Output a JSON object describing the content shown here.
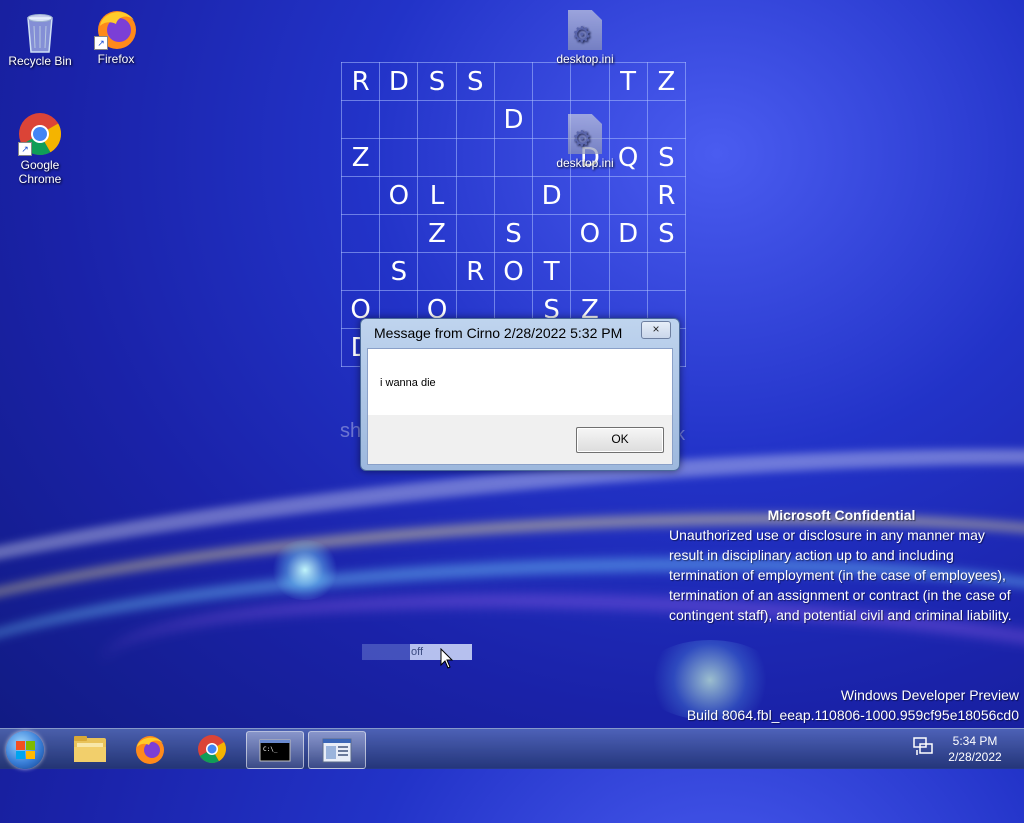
{
  "desktop": {
    "icons": [
      {
        "label": "Recycle Bin",
        "icon": "recycle-bin-icon"
      },
      {
        "label": "Firefox",
        "icon": "firefox-icon"
      },
      {
        "label": "Google Chrome",
        "icon": "chrome-icon"
      },
      {
        "label": "desktop.ini",
        "icon": "settings-file-icon"
      },
      {
        "label": "desktop.ini",
        "icon": "settings-file-icon"
      }
    ]
  },
  "grid": {
    "rows": [
      [
        "R",
        "D",
        "S",
        "S",
        "",
        "",
        "",
        "T",
        "Z"
      ],
      [
        "",
        "",
        "",
        "",
        "D",
        "",
        "",
        "",
        ""
      ],
      [
        "Z",
        "",
        "",
        "",
        "",
        "",
        "D",
        "Q",
        "S"
      ],
      [
        "",
        "O",
        "L",
        "",
        "",
        "D",
        "",
        "",
        "R"
      ],
      [
        "",
        "",
        "Z",
        "",
        "S",
        "",
        "O",
        "D",
        "S"
      ],
      [
        "",
        "S",
        "",
        "R",
        "O",
        "T",
        "",
        "",
        ""
      ],
      [
        "O",
        "",
        "O",
        "",
        "",
        "S",
        "Z",
        "",
        ""
      ],
      [
        "D",
        "",
        "",
        "",
        "",
        "",
        "",
        "",
        ""
      ]
    ],
    "partial_left": "sh",
    "partial_right": "k"
  },
  "dialog": {
    "title": "Message from Cirno 2/28/2022 5:32 PM",
    "close": "×",
    "message": "i wanna die",
    "ok": "OK"
  },
  "watermark": {
    "title": "Microsoft Confidential",
    "body": "Unauthorized use or disclosure in any manner may result in disciplinary action up to and including termination of employment (in the case of employees), termination of an assignment or contract (in the case of contingent staff), and potential civil and criminal liability.",
    "build_line1": "Windows Developer Preview",
    "build_line2": "Build 8064.fbl_eeap.110806-1000.959cf95e18056cd0"
  },
  "floating_label": "off",
  "taskbar": {
    "items": [
      {
        "name": "start-button",
        "icon": "windows-orb-icon"
      },
      {
        "name": "explorer",
        "icon": "folder-icon"
      },
      {
        "name": "firefox",
        "icon": "firefox-icon"
      },
      {
        "name": "chrome",
        "icon": "chrome-icon"
      },
      {
        "name": "cmd",
        "icon": "cmd-icon"
      },
      {
        "name": "app",
        "icon": "window-icon"
      }
    ],
    "clock_time": "5:34 PM",
    "clock_date": "2/28/2022"
  }
}
